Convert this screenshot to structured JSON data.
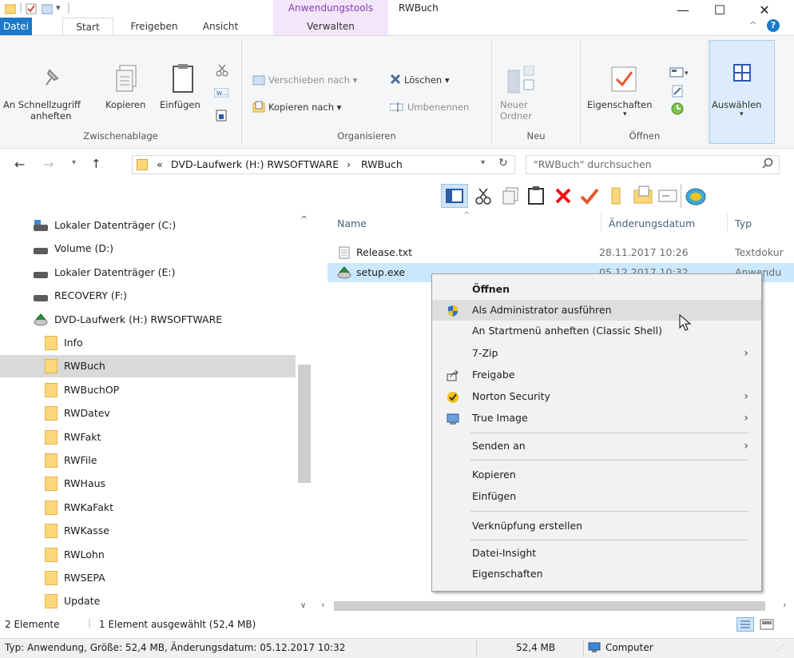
{
  "window": {
    "title": "RWBuch",
    "contextual_tab_group": "Anwendungstools",
    "minimize": "—",
    "maximize": "☐",
    "close": "✕"
  },
  "ribbon_tabs": [
    "Datei",
    "Start",
    "Freigeben",
    "Ansicht",
    "Verwalten"
  ],
  "ribbon": {
    "clipboard": {
      "pin_label_1": "An Schnellzugriff",
      "pin_label_2": "anheften",
      "copy": "Kopieren",
      "paste": "Einfügen",
      "group": "Zwischenablage"
    },
    "organize": {
      "move_to": "Verschieben nach ▾",
      "copy_to": "Kopieren nach ▾",
      "delete": "Löschen ▾",
      "rename": "Umbenennen",
      "group": "Organisieren"
    },
    "new": {
      "new_folder_1": "Neuer",
      "new_folder_2": "Ordner",
      "group": "Neu"
    },
    "open": {
      "properties": "Eigenschaften",
      "group": "Öffnen"
    },
    "select": {
      "select": "Auswählen"
    }
  },
  "address": {
    "prefix": "«",
    "crumb1": "DVD-Laufwerk (H:) RWSOFTWARE",
    "sep": "›",
    "crumb2": "RWBuch",
    "search_placeholder": "\"RWBuch\" durchsuchen"
  },
  "nav_items": [
    {
      "label": "Lokaler Datenträger (C:)",
      "type": "drive-c"
    },
    {
      "label": "Volume (D:)",
      "type": "drive"
    },
    {
      "label": "Lokaler Datenträger (E:)",
      "type": "drive"
    },
    {
      "label": "RECOVERY (F:)",
      "type": "drive"
    },
    {
      "label": "DVD-Laufwerk (H:) RWSOFTWARE",
      "type": "dvd"
    },
    {
      "label": "Info",
      "type": "folder"
    },
    {
      "label": "RWBuch",
      "type": "folder",
      "selected": true
    },
    {
      "label": "RWBuchOP",
      "type": "folder"
    },
    {
      "label": "RWDatev",
      "type": "folder"
    },
    {
      "label": "RWFakt",
      "type": "folder"
    },
    {
      "label": "RWFile",
      "type": "folder"
    },
    {
      "label": "RWHaus",
      "type": "folder"
    },
    {
      "label": "RWKaFakt",
      "type": "folder"
    },
    {
      "label": "RWKasse",
      "type": "folder"
    },
    {
      "label": "RWLohn",
      "type": "folder"
    },
    {
      "label": "RWSEPA",
      "type": "folder"
    },
    {
      "label": "Update",
      "type": "folder"
    }
  ],
  "columns": {
    "name": "Name",
    "date": "Änderungsdatum",
    "type": "Typ"
  },
  "files": [
    {
      "name": "Release.txt",
      "date": "28.11.2017 10:26",
      "type": "Textdokur"
    },
    {
      "name": "setup.exe",
      "date": "05.12.2017 10:32",
      "type": "Anwendu"
    }
  ],
  "context_menu": [
    {
      "label": "Öffnen",
      "bold": true
    },
    {
      "label": "Als Administrator ausführen",
      "icon": "shield-icon",
      "hover": true
    },
    {
      "label": "An Startmenü anheften (Classic Shell)"
    },
    {
      "label": "7-Zip",
      "submenu": true
    },
    {
      "label": "Freigabe",
      "icon": "share-icon"
    },
    {
      "label": "Norton Security",
      "icon": "norton-icon",
      "submenu": true
    },
    {
      "label": "True Image",
      "icon": "trueimage-icon",
      "submenu": true
    },
    {
      "label": "Senden an",
      "submenu": true
    },
    {
      "label": "Kopieren"
    },
    {
      "label": "Einfügen"
    },
    {
      "label": "Verknüpfung erstellen"
    },
    {
      "label": "Datei-Insight"
    },
    {
      "label": "Eigenschaften"
    }
  ],
  "status": {
    "count": "2 Elemente",
    "selected": "1 Element ausgewählt (52,4 MB)",
    "details": "Typ: Anwendung, Größe: 52,4 MB, Änderungsdatum: 05.12.2017 10:32",
    "size": "52,4 MB",
    "location": "Computer"
  },
  "colors": {
    "accent": "#1979ca",
    "selection": "#cce8ff",
    "nav_selected": "#d9d9d9",
    "menu_hover": "#dedede"
  }
}
